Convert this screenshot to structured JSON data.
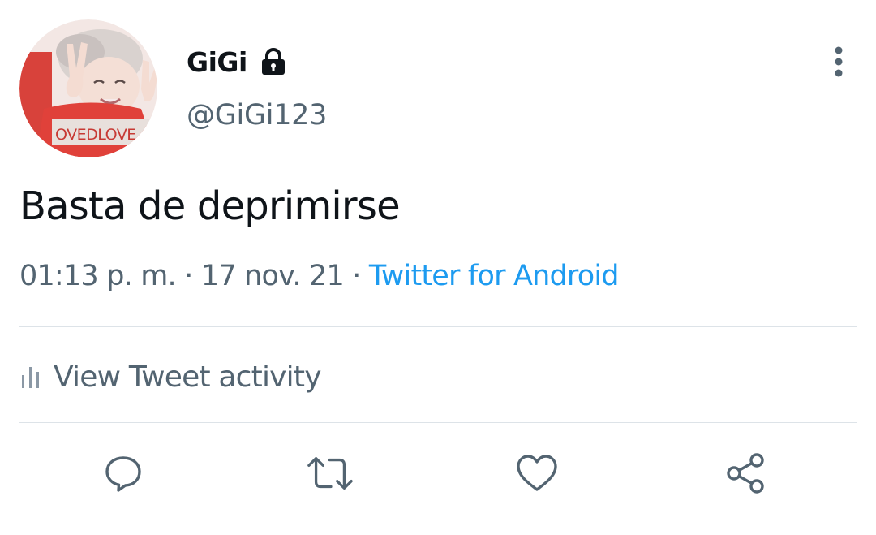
{
  "user": {
    "display_name": "GiGi",
    "handle": "@GiGi123",
    "protected": true,
    "avatar_text": "OVEDLOVE"
  },
  "tweet": {
    "text": "Basta de deprimirse",
    "time": "01:13 p. m.",
    "separator": "·",
    "date": "17 nov. 21",
    "source": "Twitter for Android"
  },
  "activity": {
    "label": "View Tweet activity",
    "icon": "bar-chart-icon"
  },
  "actions": [
    {
      "name": "reply",
      "icon": "reply-icon"
    },
    {
      "name": "retweet",
      "icon": "retweet-icon"
    },
    {
      "name": "like",
      "icon": "heart-icon"
    },
    {
      "name": "share",
      "icon": "share-icon"
    }
  ],
  "colors": {
    "text_primary": "#0f1419",
    "text_secondary": "#536471",
    "link": "#1d9bf0",
    "divider": "#dde3e8"
  }
}
